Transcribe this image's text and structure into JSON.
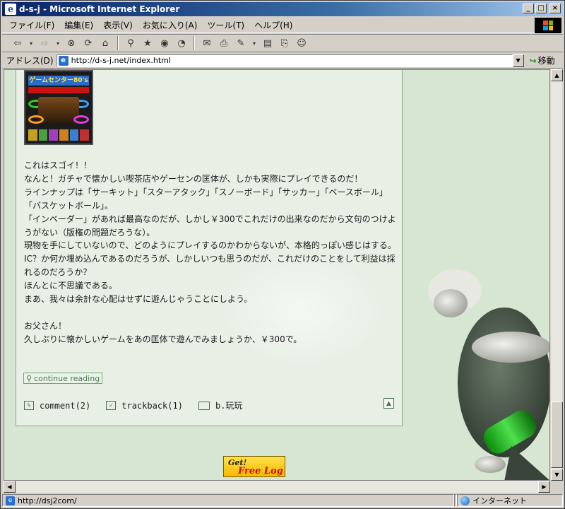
{
  "window": {
    "title": "d-s-j - Microsoft Internet Explorer",
    "controls": {
      "minimize": "_",
      "maximize": "□",
      "close": "×"
    }
  },
  "menu": [
    "ファイル(F)",
    "編集(E)",
    "表示(V)",
    "お気に入り(A)",
    "ツール(T)",
    "ヘルプ(H)"
  ],
  "address": {
    "label": "アドレス(D)",
    "url": "http://d-s-j.net/index.html",
    "go_label": "移動"
  },
  "article": {
    "thumbnail": {
      "cover_title": "ゲームセンター80's"
    },
    "paragraphs": [
      "これはスゴイ！！",
      "なんと！ガチャで懐かしい喫茶店やゲーセンの匡体が、しかも実際にプレイできるのだ！",
      "ラインナップは「サーキット」「スターアタック」「スノーボード」「サッカー」「ベースボール」「バスケットボール」。",
      "「インベーダー」があれば最高なのだが、しかし￥300でこれだけの出来なのだから文句のつけようがない（版権の問題だろうな）。",
      "現物を手にしていないので、どのようにプレイするのかわからないが、本格的っぽい感じはする。",
      "IC？か何か埋め込んであるのだろうが、しかしいつも思うのだが、これだけのことをして利益は採れるのだろうか？",
      "ほんとに不思議である。",
      "まあ、我々は余計な心配はせずに遊んじゃうことにしよう。",
      "",
      "お父さん！",
      "久しぶりに懐かしいゲームをあの匡体で遊んでみましょうか、￥300で。"
    ],
    "continue_label": "continue reading",
    "comment_label": "comment(2)",
    "trackback_label": "trackback(1)",
    "category_label": "b.玩玩"
  },
  "banner": {
    "get": "Get!",
    "free": "Free Log"
  },
  "status": {
    "url": "http://dsj2com/",
    "zone": "インターネット"
  },
  "colors": {
    "title_bar": "#0a246a",
    "page_bg": "#d6e6d2",
    "article_bg": "#e8f0e6",
    "link_green": "#4b7a4b"
  }
}
